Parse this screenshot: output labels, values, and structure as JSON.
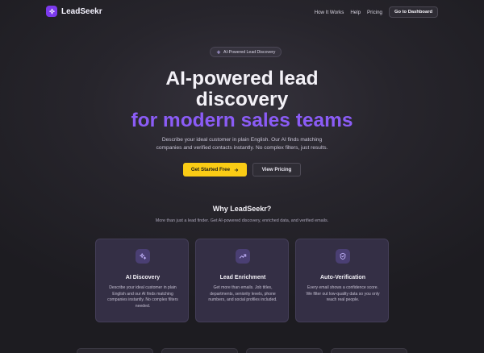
{
  "nav": {
    "logo_text": "LeadSeekr",
    "links": [
      "How It Works",
      "Help",
      "Pricing"
    ],
    "dashboard_label": "Go to Dashboard"
  },
  "hero": {
    "badge": "AI-Powered Lead Discovery",
    "title_line1": "AI-powered lead",
    "title_line2": "discovery",
    "title_line3": "for modern sales teams",
    "subtitle": "Describe your ideal customer in plain English. Our AI finds matching companies and verified contacts instantly. No complex filters, just results.",
    "cta_primary": "Get Started Free",
    "cta_secondary": "View Pricing"
  },
  "why": {
    "title": "Why LeadSeekr?",
    "subtitle": "More than just a lead finder. Get AI-powered discovery, enriched data, and verified emails."
  },
  "features": [
    {
      "icon": "sparkle-icon",
      "title": "AI Discovery",
      "description": "Describe your ideal customer in plain English and our AI finds matching companies instantly. No complex filters needed."
    },
    {
      "icon": "trending-up-icon",
      "title": "Lead Enrichment",
      "description": "Get more than emails. Job titles, departments, seniority levels, phone numbers, and social profiles included."
    },
    {
      "icon": "shield-check-icon",
      "title": "Auto-Verification",
      "description": "Every email shows a confidence score. We filter out low-quality data so you only reach real people."
    }
  ],
  "colors": {
    "accent_purple": "#8b5cf6",
    "cta_yellow": "#facc15",
    "background": "#27252c"
  }
}
